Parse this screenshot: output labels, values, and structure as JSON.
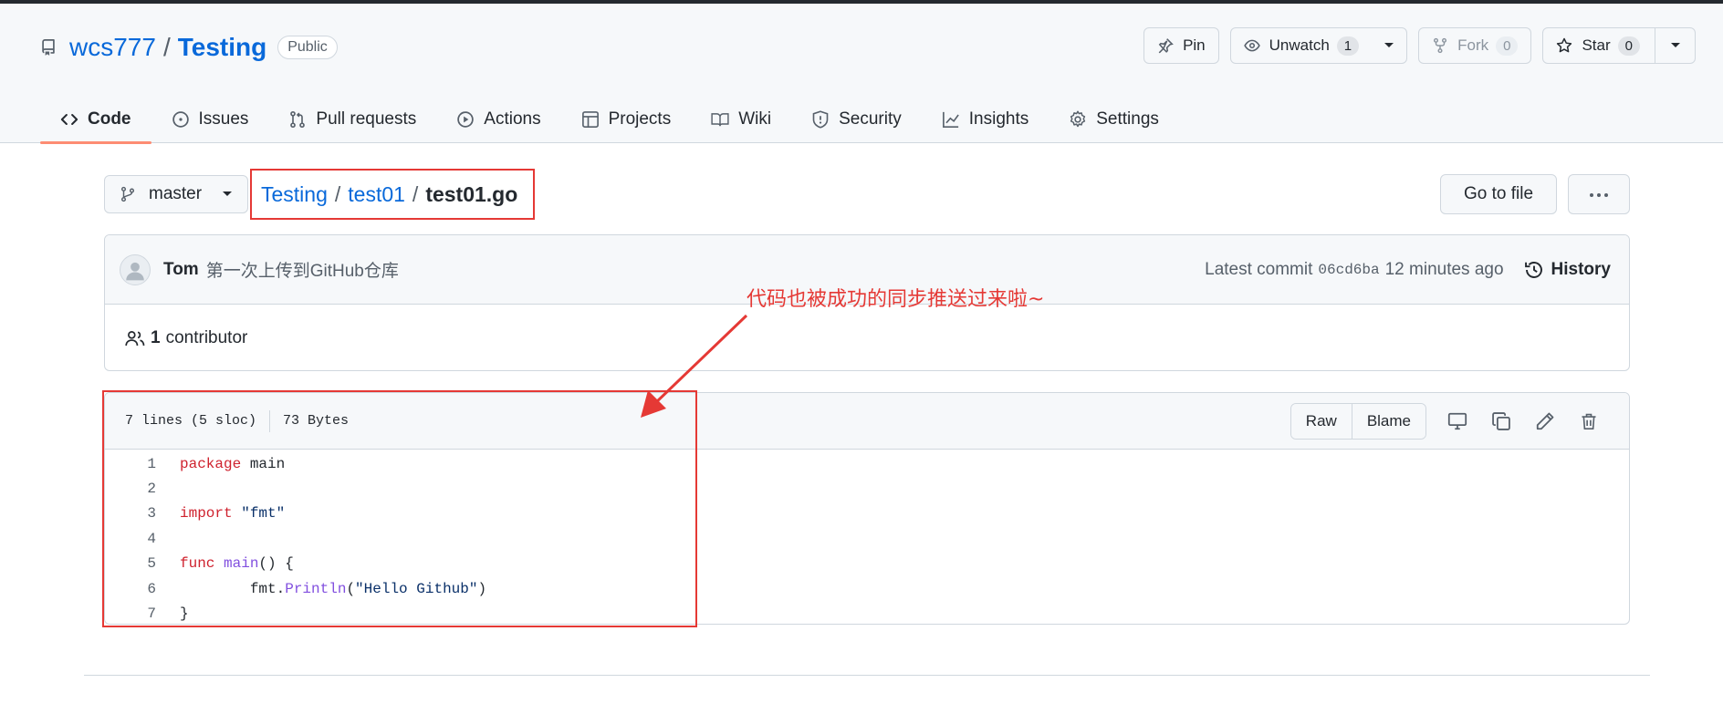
{
  "repo": {
    "owner": "wcs777",
    "separator": "/",
    "name": "Testing",
    "visibility": "Public"
  },
  "actions": {
    "pin_label": "Pin",
    "watch_label": "Unwatch",
    "watch_count": "1",
    "fork_label": "Fork",
    "fork_count": "0",
    "star_label": "Star",
    "star_count": "0"
  },
  "tabs": [
    {
      "label": "Code",
      "icon": "code-icon",
      "active": true
    },
    {
      "label": "Issues",
      "icon": "issue-icon"
    },
    {
      "label": "Pull requests",
      "icon": "pull-request-icon"
    },
    {
      "label": "Actions",
      "icon": "play-icon"
    },
    {
      "label": "Projects",
      "icon": "table-icon"
    },
    {
      "label": "Wiki",
      "icon": "book-icon"
    },
    {
      "label": "Security",
      "icon": "shield-icon"
    },
    {
      "label": "Insights",
      "icon": "graph-icon"
    },
    {
      "label": "Settings",
      "icon": "gear-icon"
    }
  ],
  "branch": {
    "name": "master"
  },
  "breadcrumb": {
    "root": "Testing",
    "folder": "test01",
    "file": "test01.go",
    "separator": "/"
  },
  "go_to_file_label": "Go to file",
  "commit": {
    "author": "Tom",
    "message": "第一次上传到GitHub仓库",
    "latest_label": "Latest commit",
    "sha": "06cd6ba",
    "time": "12 minutes ago",
    "history_label": "History"
  },
  "contributors": {
    "count": "1",
    "label": "contributor"
  },
  "file": {
    "lines_info": "7 lines (5 sloc)",
    "size": "73 Bytes",
    "raw_label": "Raw",
    "blame_label": "Blame",
    "code": [
      {
        "n": "1",
        "text": "package main"
      },
      {
        "n": "2",
        "text": ""
      },
      {
        "n": "3",
        "text": "import \"fmt\""
      },
      {
        "n": "4",
        "text": ""
      },
      {
        "n": "5",
        "text": "func main() {"
      },
      {
        "n": "6",
        "text": "        fmt.Println(\"Hello Github\")"
      },
      {
        "n": "7",
        "text": "}"
      }
    ]
  },
  "annotation": {
    "text": "代码也被成功的同步推送过来啦~",
    "color": "#e53935"
  },
  "colors": {
    "link": "#0969da",
    "keyword": "#cf222e",
    "function": "#8250df",
    "string": "#0a3069",
    "active_tab": "#fd8c73"
  }
}
